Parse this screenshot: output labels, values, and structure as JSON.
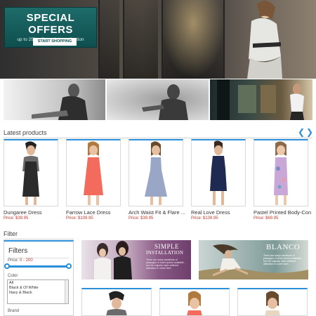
{
  "hero": {
    "title": "SPECIAL OFFERS",
    "subtitle": "up to 25% off on winter collection",
    "button": "START SHOPPING"
  },
  "latest": {
    "title": "Latest products",
    "prev_icon": "chevron-left-icon",
    "next_icon": "chevron-right-icon",
    "products": [
      {
        "name": "Dungaree Dress",
        "price": "Price: $39.95",
        "dress_color": "#2b2b2b"
      },
      {
        "name": "Farrow Lace Dress",
        "price": "Price: $109.95",
        "dress_color": "#f36b5c"
      },
      {
        "name": "Arch Waist Fit & Flare ...",
        "price": "Price: $39.95",
        "dress_color": "#9aa6c6"
      },
      {
        "name": "Real Love Dress",
        "price": "Price: $139.95",
        "dress_color": "#1e2a52"
      },
      {
        "name": "Pastel Printed Body-Con",
        "price": "Price: $69.95",
        "dress_color": "#c9a8d8"
      }
    ]
  },
  "filter": {
    "section_title": "Filter",
    "box_title": "Filters",
    "price_label": "Price:",
    "price_value": "0 - 200",
    "color_label": "Color",
    "color_options": [
      "All",
      "Black & Of White",
      "Navy & Black"
    ],
    "brand_label": "Brand"
  },
  "banners": {
    "left_title": "SIMPLE",
    "left_title2": "INSTALLATION",
    "left_sub": "There are many variations of passages of lorem ipsum available, but the majority have suffered alteration in some form",
    "right_title": "BLANCO",
    "right_sub": "There are many variations of passages of lorem ipsum available, but the majority have suffered alteration in some form"
  },
  "colors": {
    "accent": "#2a8fd8",
    "price": "#c0392b",
    "offer_bg": "#1d6c6a"
  }
}
